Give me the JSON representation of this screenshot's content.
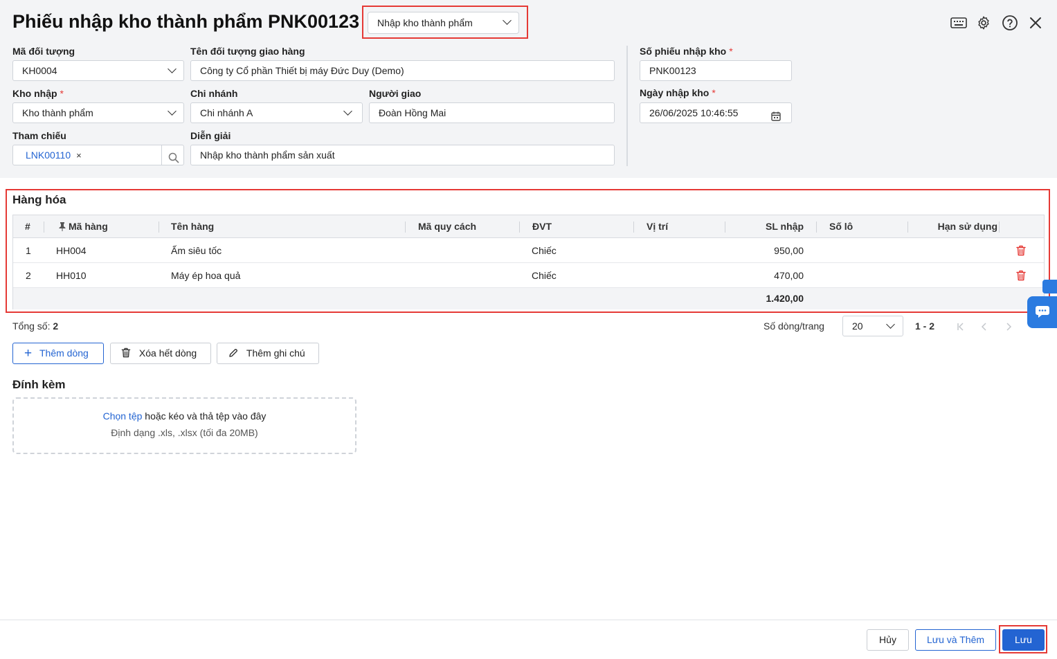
{
  "header": {
    "title": "Phiếu nhập kho thành phẩm PNK00123",
    "type_select": "Nhập kho thành phẩm",
    "icons": [
      "keyboard-icon",
      "gear-icon",
      "help-icon",
      "close-icon"
    ]
  },
  "form": {
    "ma_doi_tuong": {
      "label": "Mã đối tượng",
      "value": "KH0004"
    },
    "ten_doi_tuong": {
      "label": "Tên đối tượng giao hàng",
      "value": "Công ty Cổ phần Thiết bị máy Đức Duy (Demo)"
    },
    "kho_nhap": {
      "label": "Kho nhập",
      "required": "*",
      "value": "Kho thành phẩm"
    },
    "chi_nhanh": {
      "label": "Chi nhánh",
      "value": "Chi nhánh A"
    },
    "nguoi_giao": {
      "label": "Người giao",
      "value": "Đoàn Hồng Mai"
    },
    "tham_chieu": {
      "label": "Tham chiếu",
      "tag": "LNK00110",
      "tag_remove": "×"
    },
    "dien_giai": {
      "label": "Diễn giải",
      "value": "Nhập kho thành phẩm sản xuất"
    },
    "so_phieu": {
      "label": "Số phiếu nhập kho",
      "required": "*",
      "value": "PNK00123"
    },
    "ngay_nhap": {
      "label": "Ngày nhập kho",
      "required": "*",
      "value": "26/06/2025 10:46:55"
    }
  },
  "goods": {
    "title": "Hàng hóa",
    "columns": [
      "#",
      "Mã hàng",
      "Tên hàng",
      "Mã quy cách",
      "ĐVT",
      "Vị trí",
      "SL nhập",
      "Số lô",
      "Hạn sử dụng"
    ],
    "rows": [
      {
        "no": "1",
        "code": "HH004",
        "name": "Ấm siêu tốc",
        "spec": "",
        "unit": "Chiếc",
        "location": "",
        "qty": "950,00",
        "lot": "",
        "expiry": ""
      },
      {
        "no": "2",
        "code": "HH010",
        "name": "Máy ép hoa quả",
        "spec": "",
        "unit": "Chiếc",
        "location": "",
        "qty": "470,00",
        "lot": "",
        "expiry": ""
      }
    ],
    "total_qty": "1.420,00"
  },
  "pager": {
    "total_label": "Tổng số:",
    "total_value": "2",
    "rows_per_page_label": "Số dòng/trang",
    "rows_per_page": "20",
    "range": "1 - 2"
  },
  "actions": {
    "add_row": "Thêm dòng",
    "clear_rows": "Xóa hết dòng",
    "add_note": "Thêm ghi chú"
  },
  "attachments": {
    "title": "Đính kèm",
    "choose_link": "Chọn tệp",
    "drop_text": "hoặc kéo và thả tệp vào đây",
    "format_hint": "Định dạng .xls, .xlsx (tối đa 20MB)"
  },
  "footer": {
    "cancel": "Hủy",
    "save_and_add": "Lưu và Thêm",
    "save": "Lưu"
  },
  "colors": {
    "accent": "#2364d2",
    "danger": "#e53935",
    "highlight_box": "#e53935"
  }
}
